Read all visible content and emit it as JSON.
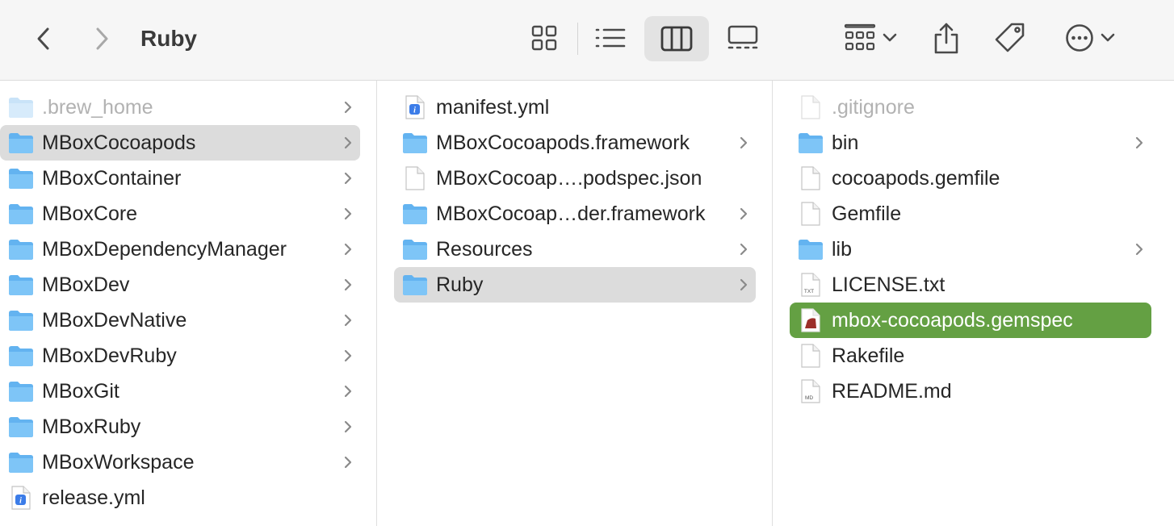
{
  "toolbar": {
    "title": "Ruby",
    "back_icon": "chevron-left-icon",
    "forward_icon": "chevron-right-icon",
    "views": [
      "icon-view",
      "list-view",
      "column-view",
      "gallery-view"
    ],
    "active_view": "column-view"
  },
  "columns": [
    {
      "items": [
        {
          "name": ".brew_home",
          "kind": "folder",
          "dim": true,
          "chevron": true
        },
        {
          "name": "MBoxCocoapods",
          "kind": "folder",
          "chevron": true,
          "state": "highlighted"
        },
        {
          "name": "MBoxContainer",
          "kind": "folder",
          "chevron": true
        },
        {
          "name": "MBoxCore",
          "kind": "folder",
          "chevron": true
        },
        {
          "name": "MBoxDependencyManager",
          "kind": "folder",
          "chevron": true
        },
        {
          "name": "MBoxDev",
          "kind": "folder",
          "chevron": true
        },
        {
          "name": "MBoxDevNative",
          "kind": "folder",
          "chevron": true
        },
        {
          "name": "MBoxDevRuby",
          "kind": "folder",
          "chevron": true
        },
        {
          "name": "MBoxGit",
          "kind": "folder",
          "chevron": true
        },
        {
          "name": "MBoxRuby",
          "kind": "folder",
          "chevron": true
        },
        {
          "name": "MBoxWorkspace",
          "kind": "folder",
          "chevron": true
        },
        {
          "name": "release.yml",
          "kind": "yml",
          "chevron": false
        }
      ]
    },
    {
      "items": [
        {
          "name": "manifest.yml",
          "kind": "yml",
          "chevron": false
        },
        {
          "name": "MBoxCocoapods.framework",
          "kind": "folder",
          "chevron": true
        },
        {
          "name": "MBoxCocoap….podspec.json",
          "kind": "doc",
          "chevron": false
        },
        {
          "name": "MBoxCocoap…der.framework",
          "kind": "folder",
          "chevron": true
        },
        {
          "name": "Resources",
          "kind": "folder",
          "chevron": true
        },
        {
          "name": "Ruby",
          "kind": "folder",
          "chevron": true,
          "state": "highlighted"
        }
      ]
    },
    {
      "items": [
        {
          "name": ".gitignore",
          "kind": "doc",
          "dim": true,
          "chevron": false
        },
        {
          "name": "bin",
          "kind": "folder",
          "chevron": true
        },
        {
          "name": "cocoapods.gemfile",
          "kind": "doc",
          "chevron": false
        },
        {
          "name": "Gemfile",
          "kind": "doc",
          "chevron": false
        },
        {
          "name": "lib",
          "kind": "folder",
          "chevron": true
        },
        {
          "name": "LICENSE.txt",
          "kind": "txt",
          "tag": "TXT",
          "chevron": false
        },
        {
          "name": "mbox-cocoapods.gemspec",
          "kind": "ruby",
          "chevron": false,
          "state": "selected"
        },
        {
          "name": "Rakefile",
          "kind": "doc",
          "chevron": false
        },
        {
          "name": "README.md",
          "kind": "txt",
          "tag": "MD",
          "chevron": false
        }
      ]
    }
  ],
  "colors": {
    "selection": "#64a043",
    "highlight": "#dcdcdc",
    "folder": "#5aaeef"
  }
}
